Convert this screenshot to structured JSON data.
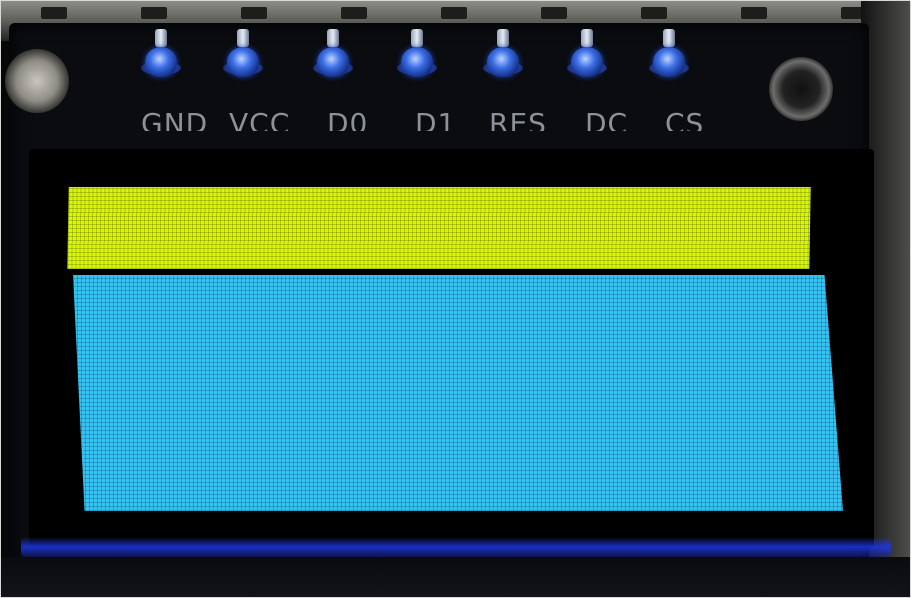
{
  "pin_labels": {
    "gnd": "GND",
    "vcc": "VCC",
    "d0": "D0",
    "d1": "D1",
    "res": "RES",
    "dc": "DC",
    "cs": "CS"
  },
  "colors": {
    "oled_yellow": "#d8f50a",
    "oled_cyan": "#33c5f2",
    "pcb": "#0a0c10",
    "pin_solder": "#3d6fe6",
    "silkscreen": "#8c9296"
  }
}
